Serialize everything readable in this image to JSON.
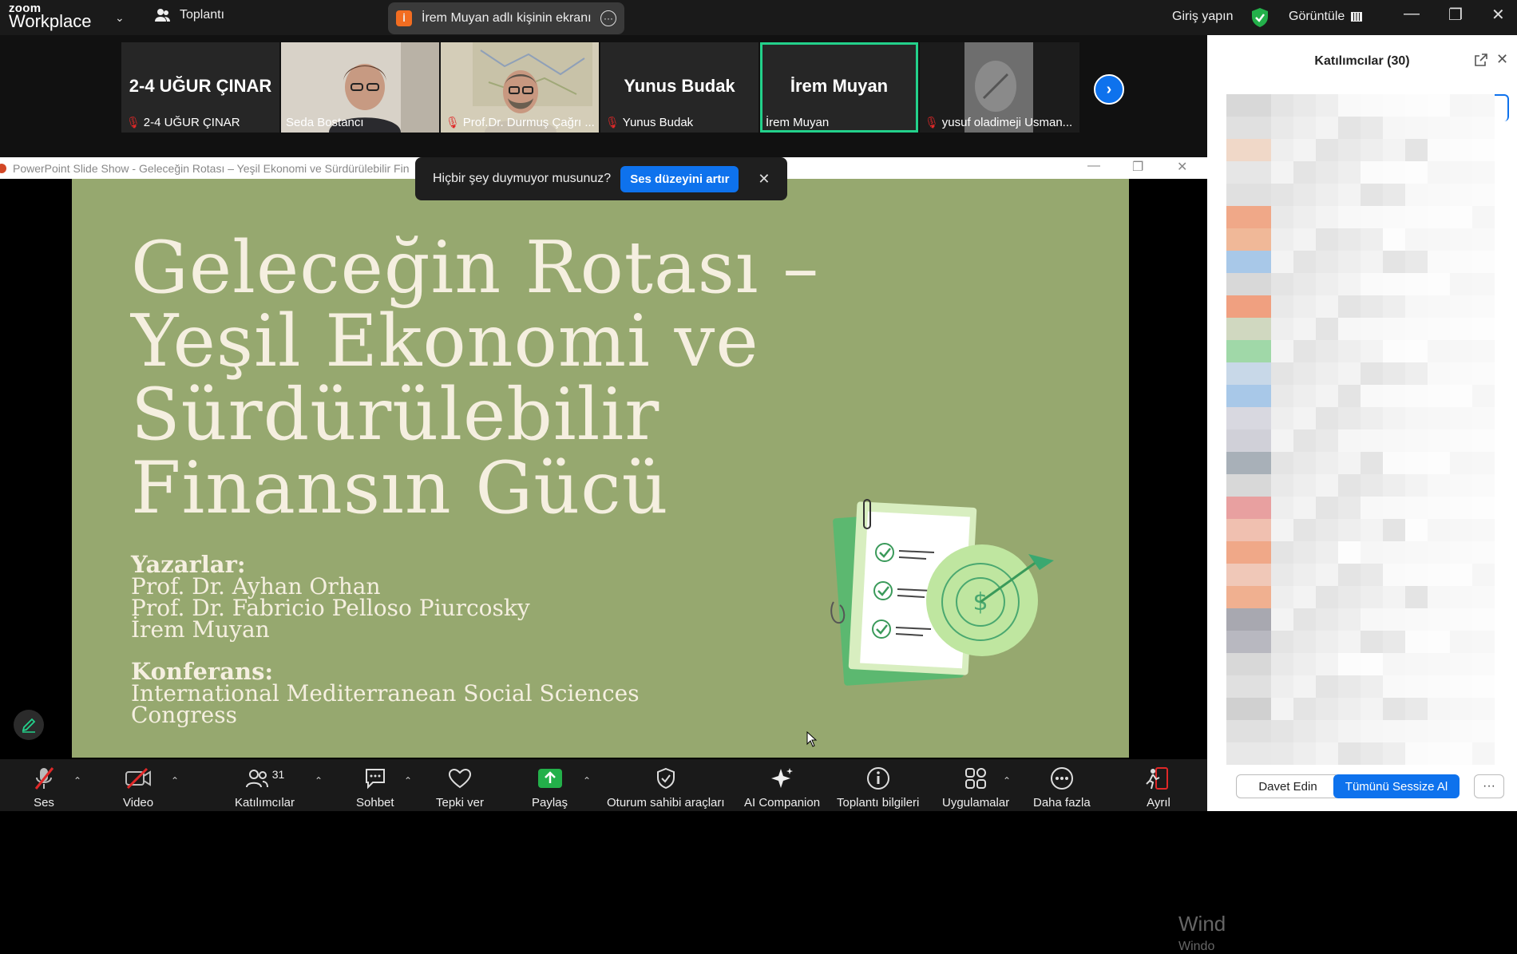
{
  "topbar": {
    "logo_small": "zoom",
    "logo_big": "Workplace",
    "meeting_label": "Toplantı",
    "share_badge": "İ",
    "share_text": "İrem Muyan adlı kişinin ekranı",
    "signin": "Giriş yapın",
    "view_label": "Görüntüle"
  },
  "thumbnails": [
    {
      "big_name": "2-4 UĞUR ÇINAR",
      "label": "2-4 UĞUR ÇINAR",
      "muted": true,
      "video": false
    },
    {
      "big_name": "",
      "label": "Seda Bostancı",
      "muted": false,
      "video": true
    },
    {
      "big_name": "",
      "label": "Prof.Dr. Durmuş Çağrı ...",
      "muted": true,
      "video": true
    },
    {
      "big_name": "Yunus Budak",
      "label": "Yunus Budak",
      "muted": true,
      "video": false
    },
    {
      "big_name": "İrem Muyan",
      "label": "İrem Muyan",
      "muted": false,
      "video": false,
      "active": true
    },
    {
      "big_name": "",
      "label": "yusuf oladimeji Usman...",
      "muted": true,
      "video": true
    }
  ],
  "ppt": {
    "window_title": "PowerPoint Slide Show  -  Geleceğin Rotası – Yeşil Ekonomi ve Sürdürülebilir Fin"
  },
  "toast": {
    "text": "Hiçbir şey duymuyor musunuz?",
    "button": "Ses düzeyini artır"
  },
  "slide": {
    "title_lines": [
      "Geleceğin Rotası –",
      "Yeşil Ekonomi ve",
      "Sürdürülebilir",
      "Finansın Gücü"
    ],
    "authors_header": "Yazarlar:",
    "authors": [
      "Prof. Dr. Ayhan Orhan",
      "Prof. Dr. Fabricio Pelloso Piurcosky",
      "İrem Muyan"
    ],
    "conf_header": "Konferans:",
    "conf_lines": [
      "International Mediterranean Social Sciences",
      "Congress"
    ]
  },
  "watermark": {
    "line1": "Wind",
    "line2": "Windo"
  },
  "panel": {
    "title": "Katılımcılar (30)",
    "invite": "Davet Edin",
    "mute_all": "Tümünü Sessize Al"
  },
  "toolbar": {
    "audio": "Ses",
    "video": "Video",
    "participants": "Katılımcılar",
    "participants_count": "31",
    "chat": "Sohbet",
    "react": "Tepki ver",
    "share": "Paylaş",
    "host_tools": "Oturum sahibi araçları",
    "ai": "AI Companion",
    "info": "Toplantı bilgileri",
    "apps": "Uygulamalar",
    "more": "Daha fazla",
    "leave": "Ayrıl"
  },
  "colors": {
    "accent": "#0e72ed",
    "slide_bg": "#96a86f",
    "active_tile": "#23d18b",
    "mute_red": "#e02828"
  }
}
